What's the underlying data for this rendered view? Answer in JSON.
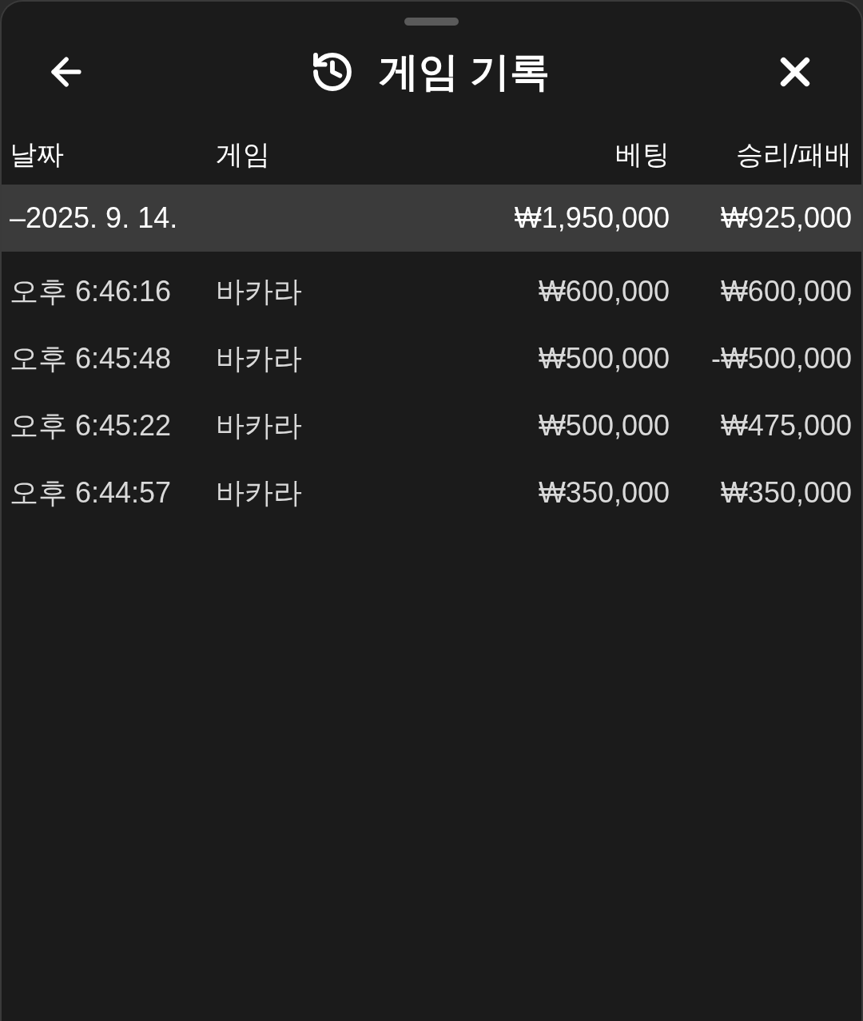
{
  "header": {
    "title": "게임 기록"
  },
  "table": {
    "columns": [
      "날짜",
      "게임",
      "베팅",
      "승리/패배"
    ],
    "groups": [
      {
        "marker": "–",
        "date": "2025. 9. 14.",
        "bet": "₩1,950,000",
        "result": "₩925,000",
        "rows": [
          {
            "time": "오후 6:46:16",
            "game": "바카라",
            "bet": "₩600,000",
            "result": "₩600,000"
          },
          {
            "time": "오후 6:45:48",
            "game": "바카라",
            "bet": "₩500,000",
            "result": "-₩500,000"
          },
          {
            "time": "오후 6:45:22",
            "game": "바카라",
            "bet": "₩500,000",
            "result": "₩475,000"
          },
          {
            "time": "오후 6:44:57",
            "game": "바카라",
            "bet": "₩350,000",
            "result": "₩350,000"
          }
        ]
      }
    ]
  }
}
